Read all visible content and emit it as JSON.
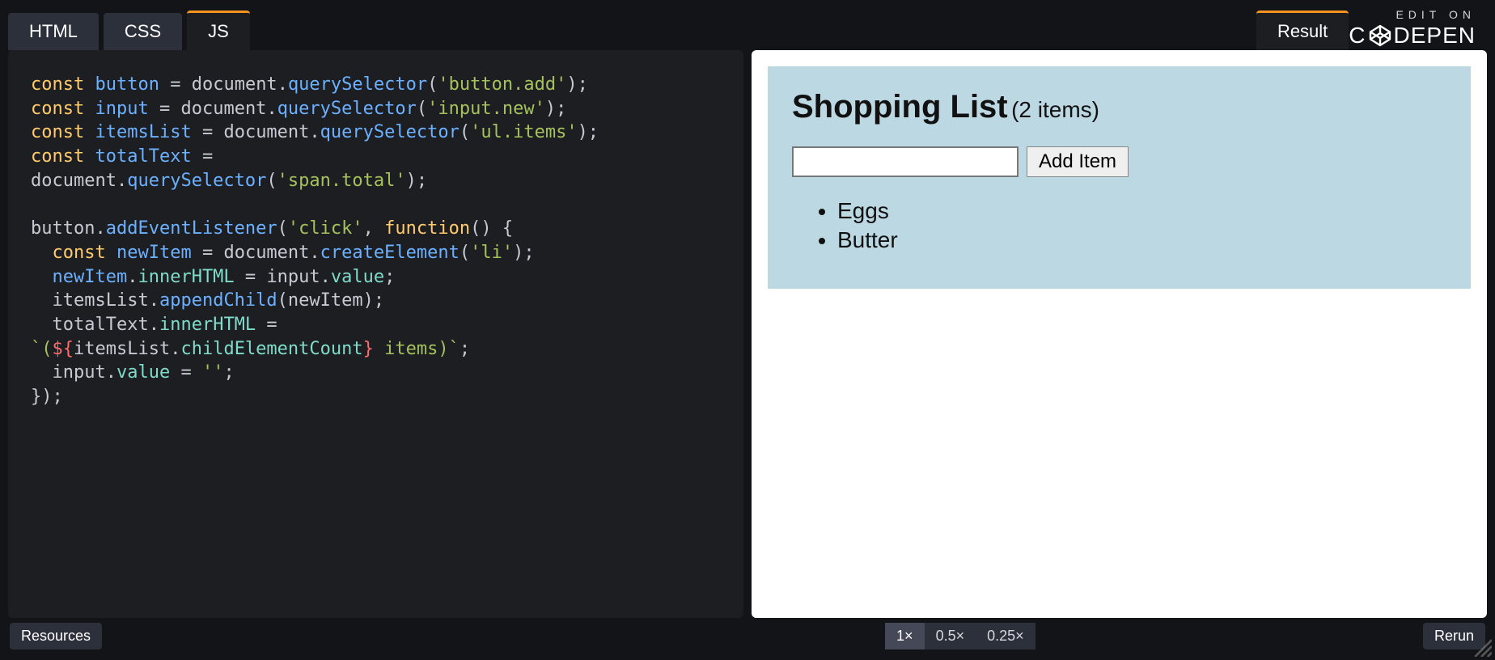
{
  "tabs": {
    "html": "HTML",
    "css": "CSS",
    "js": "JS",
    "result": "Result",
    "active": "JS"
  },
  "brand": {
    "edit_on": "EDIT ON",
    "name_left": "C",
    "name_right": "DEPEN"
  },
  "code": {
    "l1": {
      "kw": "const",
      "sp": " ",
      "id": "button",
      "eq": " = ",
      "obj": "document",
      "dot": ".",
      "fn": "querySelector",
      "p1": "(",
      "s": "'button.add'",
      "p2": ");"
    },
    "l2": {
      "kw": "const",
      "sp": " ",
      "id": "input",
      "eq": " = ",
      "obj": "document",
      "dot": ".",
      "fn": "querySelector",
      "p1": "(",
      "s": "'input.new'",
      "p2": ");"
    },
    "l3": {
      "kw": "const",
      "sp": " ",
      "id": "itemsList",
      "eq": " = ",
      "obj": "document",
      "dot": ".",
      "fn": "querySelector",
      "p1": "(",
      "s": "'ul.items'",
      "p2": ");"
    },
    "l4": {
      "kw": "const",
      "sp": " ",
      "id": "totalText",
      "eq": " ="
    },
    "l5": {
      "obj": "document",
      "dot": ".",
      "fn": "querySelector",
      "p1": "(",
      "s": "'span.total'",
      "p2": ");"
    },
    "l7a": {
      "id": "button",
      "dot": ".",
      "fn": "addEventListener",
      "p1": "(",
      "s": "'click'",
      "comma": ", ",
      "kw": "function",
      "p2": "() {"
    },
    "l8": {
      "ind": "  ",
      "kw": "const",
      "sp": " ",
      "id": "newItem",
      "eq": " = ",
      "obj": "document",
      "dot": ".",
      "fn": "createElement",
      "p1": "(",
      "s": "'li'",
      "p2": ");"
    },
    "l9": {
      "ind": "  ",
      "id": "newItem",
      "dot": ".",
      "prop": "innerHTML",
      "eq": " = ",
      "id2": "input",
      "dot2": ".",
      "prop2": "value",
      "semi": ";"
    },
    "l10": {
      "ind": "  ",
      "id": "itemsList",
      "dot": ".",
      "fn": "appendChild",
      "p1": "(",
      "id2": "newItem",
      "p2": ");"
    },
    "l11": {
      "ind": "  ",
      "id": "totalText",
      "dot": ".",
      "prop": "innerHTML",
      "eq": " ="
    },
    "l12": {
      "bt": "`",
      "p1": "(",
      "d": "${",
      "id": "itemsList",
      "dot": ".",
      "prop": "childElementCount",
      "cb": "}",
      "sp": " ",
      "txt": "items",
      "p2": ")",
      "bt2": "`",
      "semi": ";"
    },
    "l13": {
      "ind": "  ",
      "id": "input",
      "dot": ".",
      "prop": "value",
      "eq": " = ",
      "s": "''",
      "semi": ";"
    },
    "l14": {
      "close": "});"
    }
  },
  "result": {
    "heading": "Shopping List",
    "count_text": "(2 items)",
    "input_value": "",
    "button_label": "Add Item",
    "items": [
      "Eggs",
      "Butter"
    ]
  },
  "bottom": {
    "resources": "Resources",
    "zoom": [
      "1×",
      "0.5×",
      "0.25×"
    ],
    "zoom_active": "1×",
    "rerun": "Rerun"
  }
}
